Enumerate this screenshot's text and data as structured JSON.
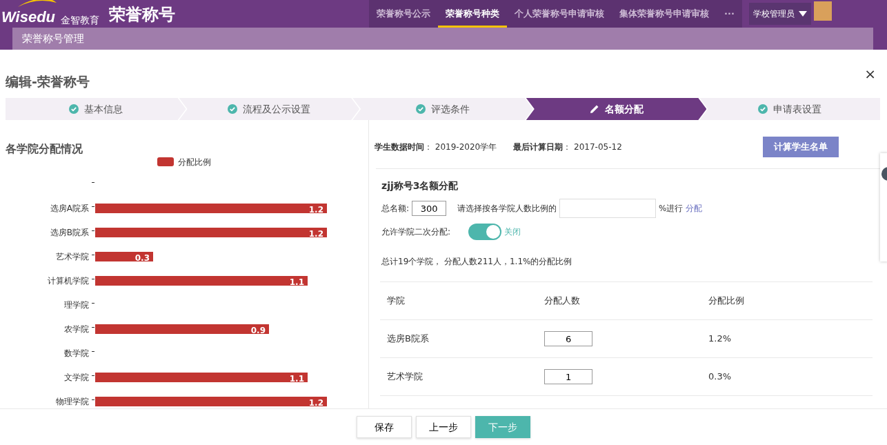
{
  "header": {
    "logo": "Wisedu",
    "logo_subtitle": "金智教育",
    "app_title": "荣誉称号",
    "nav": [
      {
        "label": "荣誉称号公示",
        "selected": false
      },
      {
        "label": "荣誉称号种类",
        "selected": true
      },
      {
        "label": "个人荣誉称号申请审核",
        "selected": false
      },
      {
        "label": "集体荣誉称号申请审核",
        "selected": false
      }
    ],
    "more": "···",
    "user": "学校管理员"
  },
  "breadcrumb": "荣誉称号管理",
  "dialog": {
    "title": "编辑-荣誉称号",
    "close": "×"
  },
  "steps": [
    {
      "label": "基本信息",
      "done": true,
      "selected": false
    },
    {
      "label": "流程及公示设置",
      "done": true,
      "selected": false
    },
    {
      "label": "评选条件",
      "done": true,
      "selected": false
    },
    {
      "label": "名额分配",
      "done": false,
      "selected": true
    },
    {
      "label": "申请表设置",
      "done": true,
      "selected": false
    }
  ],
  "chart_panel": {
    "title": "各学院分配情况",
    "chart_data": {
      "type": "bar",
      "orientation": "horizontal",
      "categories": [
        "选房A院系",
        "选房B院系",
        "艺术学院",
        "计算机学院",
        "理学院",
        "农学院",
        "数学院",
        "文学院",
        "物理学院"
      ],
      "series": [
        {
          "name": "分配比例",
          "color": "#c23531",
          "values": [
            1.2,
            1.2,
            0.3,
            1.1,
            null,
            0.9,
            null,
            1.1,
            1.2
          ]
        }
      ],
      "data_labels": true
    }
  },
  "info": [
    "**学生数据时间**： 2019-2020学年",
    "**最后计算日期**： 2017-05-12"
  ],
  "calc_button": "计算学生名单",
  "section_title": "zjj称号3名额分配",
  "total_label": "总名额:",
  "total_value": "300",
  "ratio_label": "请选择按各学院人数比例的",
  "ratio_suffix": "%进行",
  "allocate_link": "分配",
  "second_allocation": {
    "label": "允许学院二次分配:",
    "on": true,
    "state_text": "关闭"
  },
  "summary": "总计19个学院， 分配人数211人，1.1%的分配比例",
  "table": {
    "columns": [
      "学院",
      "分配人数",
      "分配比例"
    ],
    "rows": [
      {
        "college": "选房B院系",
        "count": "6",
        "ratio": "1.2%"
      },
      {
        "college": "艺术学院",
        "count": "1",
        "ratio": "0.3%"
      }
    ]
  },
  "footer_buttons": [
    {
      "label": "保存",
      "kind": "default"
    },
    {
      "label": "上一步",
      "kind": "default"
    },
    {
      "label": "下一步",
      "kind": "primary"
    }
  ]
}
